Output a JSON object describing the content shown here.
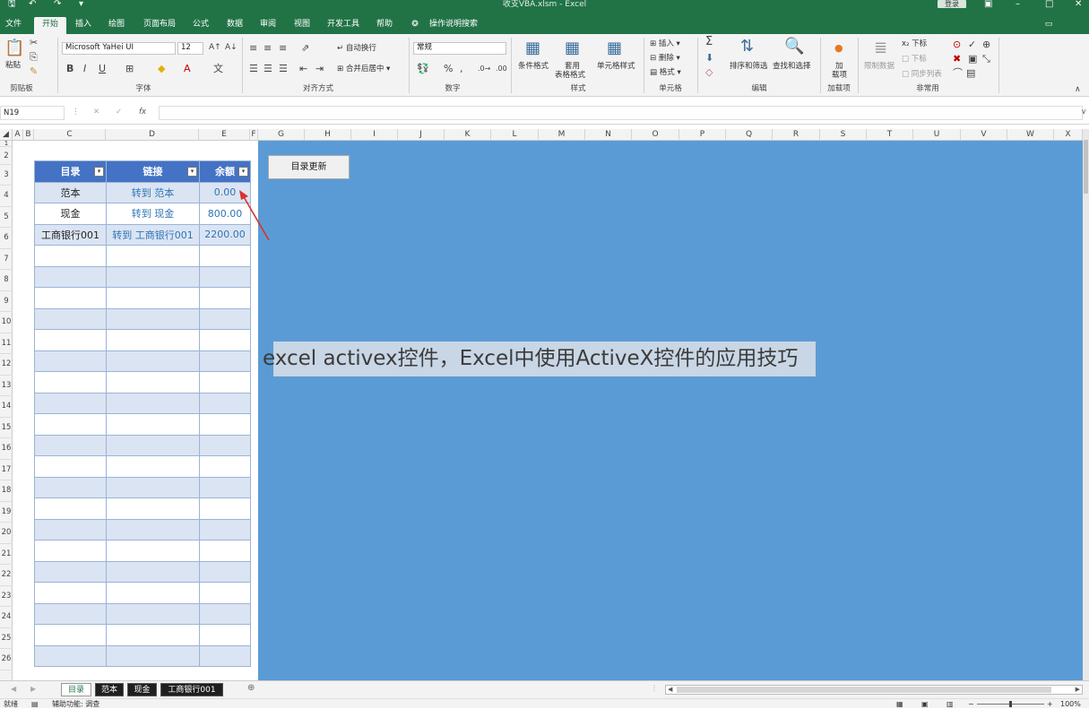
{
  "window": {
    "title": "收支VBA.xlsm - Excel",
    "login_label": "登录",
    "save_icon": "save-icon",
    "undo_icon": "undo-icon",
    "redo_icon": "redo-icon"
  },
  "ribbon_tabs": [
    {
      "label": "文件"
    },
    {
      "label": "开始",
      "active": true
    },
    {
      "label": "插入"
    },
    {
      "label": "绘图"
    },
    {
      "label": "页面布局"
    },
    {
      "label": "公式"
    },
    {
      "label": "数据"
    },
    {
      "label": "审阅"
    },
    {
      "label": "视图"
    },
    {
      "label": "开发工具"
    },
    {
      "label": "帮助"
    },
    {
      "label": "操作说明搜索"
    }
  ],
  "ribbon": {
    "clipboard": {
      "paste": "粘贴",
      "group": "剪贴板"
    },
    "font": {
      "name": "Microsoft YaHei UI",
      "size": "12",
      "group": "字体",
      "bold": "B",
      "italic": "I",
      "underline": "U"
    },
    "alignment": {
      "wrap": "自动换行",
      "merge": "合并后居中",
      "group": "对齐方式"
    },
    "number": {
      "format": "常规",
      "percent": "%",
      "comma": ",",
      "group": "数字"
    },
    "styles": {
      "conditional": "条件格式",
      "table_format_1": "套用",
      "table_format_2": "表格格式",
      "cell_styles": "单元格样式",
      "group": "样式"
    },
    "cells": {
      "insert": "插入",
      "delete": "删除",
      "format": "格式",
      "group": "单元格"
    },
    "editing": {
      "sort_filter": "排序和筛选",
      "find_select": "查找和选择",
      "group": "编辑"
    },
    "addins": {
      "label_1": "加",
      "label_2": "载项",
      "group": "加载项"
    },
    "common": {
      "restrict": "限制数据",
      "down": "下标",
      "down2": "下标",
      "sync": "同步列表",
      "group": "非常用"
    }
  },
  "formula_bar": {
    "name_box": "N19",
    "fx": "fx",
    "cancel": "✕",
    "enter": "✓",
    "formula": ""
  },
  "columns": [
    "A",
    "B",
    "C",
    "D",
    "E",
    "F",
    "G",
    "H",
    "I",
    "J",
    "K",
    "L",
    "M",
    "N",
    "O",
    "P",
    "Q",
    "R",
    "S",
    "T",
    "U",
    "V",
    "W",
    "X"
  ],
  "rows": [
    "1",
    "2",
    "3",
    "4",
    "5",
    "6",
    "7",
    "8",
    "9",
    "10",
    "11",
    "12",
    "13",
    "14",
    "15",
    "16",
    "17",
    "18",
    "19",
    "20",
    "21",
    "22",
    "23",
    "24",
    "25",
    "26"
  ],
  "table": {
    "headers": [
      "目录",
      "链接",
      "余额"
    ],
    "rows": [
      {
        "name": "范本",
        "link": "转到 范本",
        "balance": "0.00"
      },
      {
        "name": "现金",
        "link": "转到 现金",
        "balance": "800.00"
      },
      {
        "name": "工商银行001",
        "link": "转到 工商银行001",
        "balance": "2200.00"
      }
    ]
  },
  "update_button": "目录更新",
  "caption": "excel activex控件，Excel中使用ActiveX控件的应用技巧",
  "sheet_tabs": [
    {
      "label": "目录",
      "active": true
    },
    {
      "label": "范本"
    },
    {
      "label": "现金"
    },
    {
      "label": "工商银行001"
    }
  ],
  "status": {
    "ready": "就绪",
    "accessibility": "辅助功能: 调查",
    "zoom": "100%"
  },
  "colors": {
    "excel_green": "#217346",
    "pane_blue": "#5b9bd5",
    "header_blue": "#4472c4",
    "band": "#dbe4f3",
    "link": "#2e75b6"
  }
}
